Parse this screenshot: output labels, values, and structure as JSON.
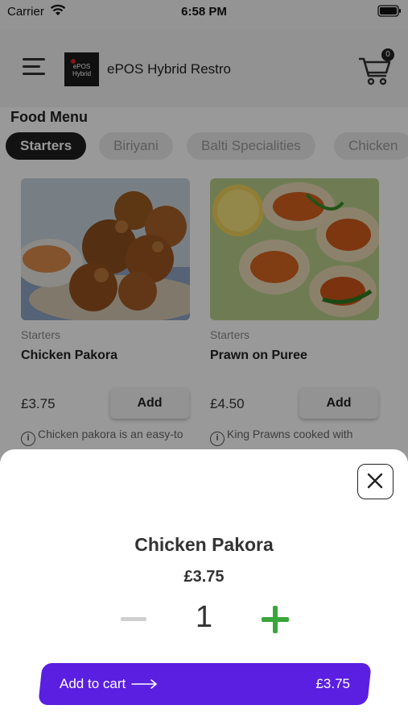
{
  "status_bar": {
    "carrier": "Carrier",
    "time": "6:58 PM"
  },
  "header": {
    "logo_text": "ePOS Hybrid",
    "brand": "ePOS Hybrid Restro",
    "cart_count": "0"
  },
  "menu": {
    "title": "Food Menu",
    "categories": [
      "Starters",
      "Biriyani",
      "Balti Specialities",
      "Chicken"
    ],
    "active_category": "Starters"
  },
  "items": [
    {
      "category": "Starters",
      "name": "Chicken Pakora",
      "price": "£3.75",
      "add_label": "Add",
      "description": "Chicken pakora is an easy-to make delicious snack recip"
    },
    {
      "category": "Starters",
      "name": "Prawn on Puree",
      "price": "£4.50",
      "add_label": "Add",
      "description": "King Prawns cooked with Nepalese spices and served"
    }
  ],
  "sheet": {
    "title": "Chicken Pakora",
    "price": "£3.75",
    "quantity": "1",
    "add_to_cart_label": "Add to cart",
    "total": "£3.75"
  },
  "colors": {
    "accent": "#5a1fe0",
    "plus": "#3aa63a",
    "chip_active": "#1f1f1f"
  }
}
